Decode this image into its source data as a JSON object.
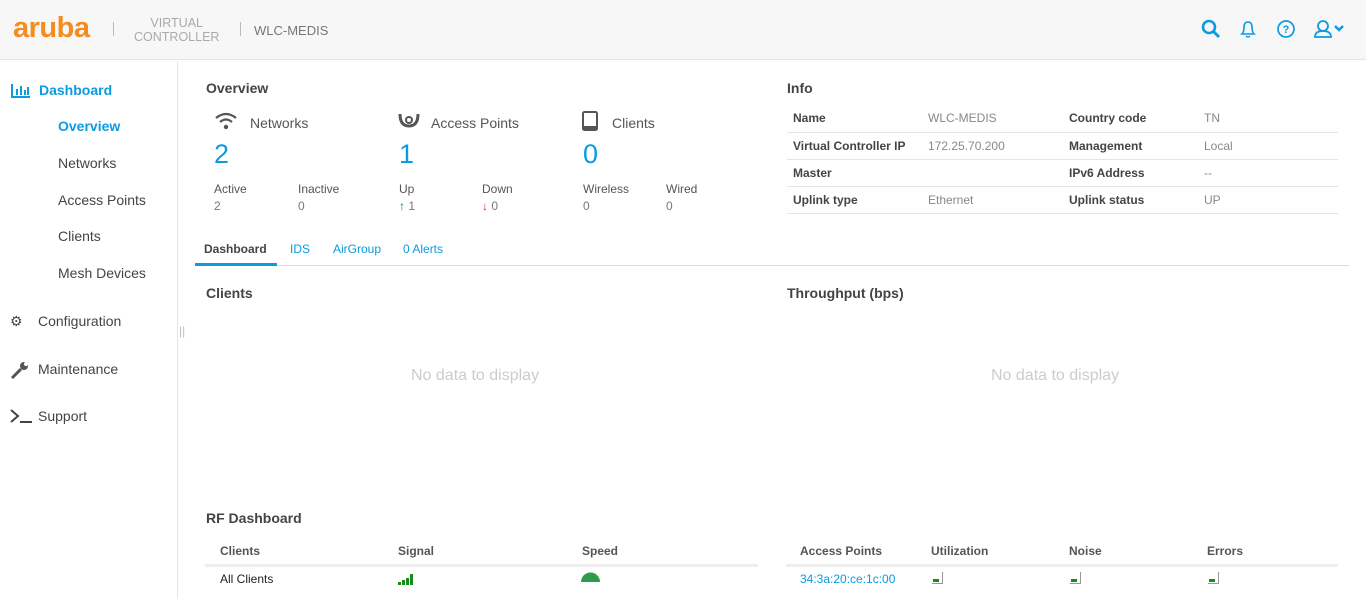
{
  "header": {
    "logo": "aruba",
    "product": "VIRTUAL CONTROLLER",
    "product_line1": "VIRTUAL",
    "product_line2": "CONTROLLER",
    "device": "WLC-MEDIS"
  },
  "icons": {
    "search": "search-icon",
    "bell": "bell-icon",
    "help": "help-icon",
    "user": "user-icon"
  },
  "accent": "#0a9be0",
  "sidebar": {
    "dashboard": "Dashboard",
    "items": [
      "Overview",
      "Networks",
      "Access Points",
      "Clients",
      "Mesh Devices"
    ],
    "configuration": "Configuration",
    "maintenance": "Maintenance",
    "support": "Support"
  },
  "overview": {
    "title": "Overview",
    "networks": {
      "label": "Networks",
      "count": "2",
      "a_label": "Active",
      "a": "2",
      "b_label": "Inactive",
      "b": "0"
    },
    "aps": {
      "label": "Access Points",
      "count": "1",
      "a_label": "Up",
      "a": "1",
      "b_label": "Down",
      "b": "0"
    },
    "clients": {
      "label": "Clients",
      "count": "0",
      "a_label": "Wireless",
      "a": "0",
      "b_label": "Wired",
      "b": "0"
    }
  },
  "info": {
    "title": "Info",
    "rows": [
      [
        "Name",
        "WLC-MEDIS",
        "Country code",
        "TN"
      ],
      [
        "Virtual Controller IP",
        "172.25.70.200",
        "Management",
        "Local"
      ],
      [
        "Master",
        "",
        "IPv6 Address",
        "--"
      ],
      [
        "Uplink type",
        "Ethernet",
        "Uplink status",
        "UP"
      ]
    ]
  },
  "tabs": [
    "Dashboard",
    "IDS",
    "AirGroup",
    "0 Alerts"
  ],
  "charts": {
    "clients_title": "Clients",
    "throughput_title": "Throughput (bps)",
    "no_data": "No data to display"
  },
  "rf": {
    "title": "RF Dashboard",
    "left_headers": [
      "Clients",
      "Signal",
      "Speed"
    ],
    "left_row": "All Clients",
    "right_headers": [
      "Access Points",
      "Utilization",
      "Noise",
      "Errors"
    ],
    "ap": "34:3a:20:ce:1c:00"
  }
}
